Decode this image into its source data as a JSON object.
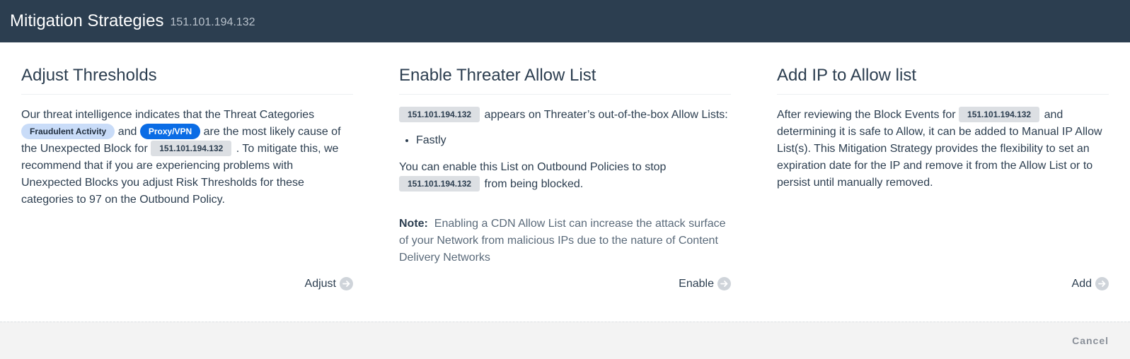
{
  "header": {
    "title": "Mitigation Strategies",
    "subtitle": "151.101.194.132"
  },
  "columns": [
    {
      "title": "Adjust Thresholds",
      "text1": "Our threat intelligence indicates that the Threat Categories",
      "tag1": "Fraudulent Activity",
      "and": "and",
      "tag2": "Proxy/VPN",
      "text2": "are the most likely cause of the Unexpected Block for",
      "ip": "151.101.194.132",
      "text3": ". To mitigate this, we recommend that if you are experiencing problems with Unexpected Blocks you adjust Risk Thresholds for these categories to 97 on the Outbound Policy.",
      "action": "Adjust"
    },
    {
      "title": "Enable Threater Allow List",
      "ip": "151.101.194.132",
      "text1": "appears on Threater’s out-of-the-box Allow Lists:",
      "list": [
        "Fastly"
      ],
      "text2": "You can enable this List on Outbound Policies to stop",
      "text3": "from being blocked.",
      "note_label": "Note:",
      "note_text": "Enabling a CDN Allow List can increase the attack surface of your Network from malicious IPs due to the nature of Content Delivery Networks",
      "action": "Enable"
    },
    {
      "title": "Add IP to Allow list",
      "text1": "After reviewing the Block Events for",
      "ip": "151.101.194.132",
      "text2": "and determining it is safe to Allow, it can be added to Manual IP Allow List(s). This Mitigation Strategy provides the flexibility to set an expiration date for the IP and remove it from the Allow List or to persist until manually removed.",
      "action": "Add"
    }
  ],
  "footer": {
    "cancel_label": "Cancel"
  }
}
